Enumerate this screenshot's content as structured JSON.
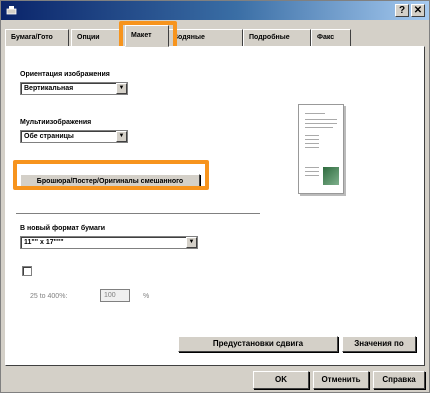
{
  "window": {
    "help_label": "?",
    "close_label": "✕"
  },
  "tabs": [
    {
      "label": "Бумага/Гото"
    },
    {
      "label": "Опции"
    },
    {
      "label": "Макет"
    },
    {
      "label": "Водяные"
    },
    {
      "label": "Подробные"
    },
    {
      "label": "Факс"
    }
  ],
  "active_tab": "Макет",
  "orientation": {
    "label": "Ориентация изображения",
    "value": "Вертикальная"
  },
  "multi": {
    "label": "Мультиизображения",
    "value": "Обе страницы"
  },
  "brochure_button": "Брошюра/Постер/Оригиналы смешанного",
  "paper": {
    "label": "В новый формат бумаги",
    "value": "11\"\" x 17\"\"\""
  },
  "scale": {
    "range": "25 to 400%:",
    "value": "100",
    "unit": "%"
  },
  "buttons": {
    "shift_presets": "Предустановки сдвига",
    "defaults": "Значения по",
    "ok": "OK",
    "cancel": "Отменить",
    "help": "Справка"
  },
  "colors": {
    "highlight": "#f7941d",
    "title_start": "#0a246a"
  },
  "icons": [
    "printer-icon",
    "help-icon",
    "close-icon",
    "dropdown-arrow-icon",
    "page-preview-icon"
  ]
}
